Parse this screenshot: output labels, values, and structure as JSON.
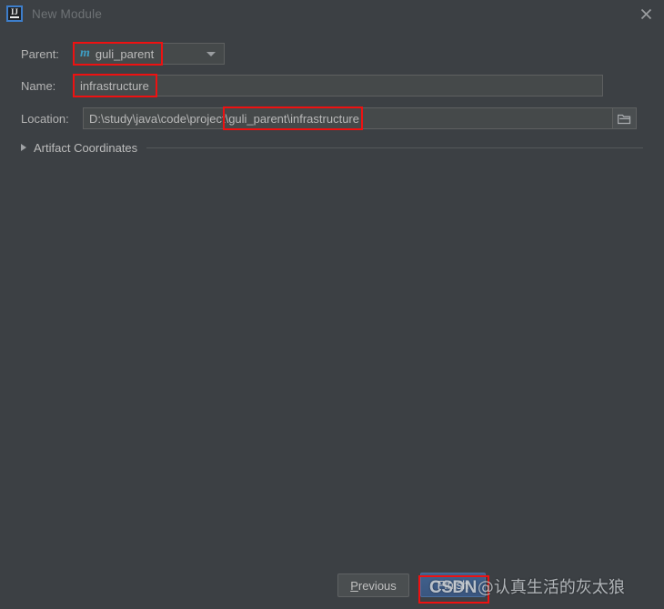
{
  "window": {
    "title": "New Module",
    "app_icon": "intellij-idea-icon",
    "icon_letters": "IJ",
    "close_icon": "close-icon",
    "background_color": "#3c4044"
  },
  "form": {
    "parent": {
      "label": "Parent:",
      "value": "guli_parent",
      "module_icon": "maven-module-icon",
      "module_icon_letter": "m",
      "module_icon_color": "#3e9ec4",
      "dropdown_icon": "chevron-down-icon"
    },
    "name": {
      "label": "Name:",
      "value": "infrastructure",
      "placeholder": ""
    },
    "location": {
      "label": "Location:",
      "value": "D:\\study\\java\\code\\project\\guli_parent\\infrastructure",
      "placeholder": "",
      "browse_icon": "folder-open-icon"
    },
    "artifact_coordinates": {
      "label": "Artifact Coordinates",
      "expanded": false,
      "toggle_icon": "chevron-right-icon"
    }
  },
  "footer": {
    "previous_label": "Previous",
    "previous_mnemonic": "P",
    "previous_rest": "revious",
    "finish_label": "Finish"
  },
  "annotations": {
    "color": "#ee1111",
    "boxes": [
      {
        "name": "parent-value-highlight"
      },
      {
        "name": "name-value-highlight"
      },
      {
        "name": "location-suffix-highlight"
      },
      {
        "name": "finish-button-highlight"
      }
    ]
  },
  "watermark": {
    "logo": "CSDN",
    "text": "@认真生活的灰太狼"
  }
}
